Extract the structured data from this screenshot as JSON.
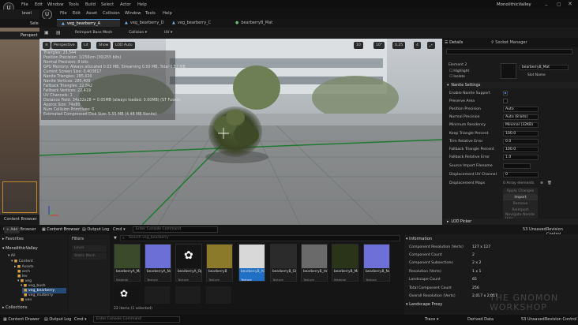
{
  "app": {
    "project": "MonolithicValley"
  },
  "menu": [
    "File",
    "Edit",
    "Window",
    "Tools",
    "Build",
    "Select",
    "Actor",
    "Help"
  ],
  "inner_menu": [
    "File",
    "Edit",
    "Asset",
    "Collision",
    "Window",
    "Tools",
    "Help"
  ],
  "outer_tabs": [
    "level",
    "Sele"
  ],
  "editor_tabs": [
    "veg_bearberry_A",
    "veg_bearberry_D",
    "veg_bearberry_C",
    "bearberryB_Mat"
  ],
  "toolbar": {
    "reimport": "Reimport Base Mesh",
    "collision": "Collision",
    "uv": "UV"
  },
  "viewport": {
    "perspective": "Perspective",
    "lit": "Lit",
    "show": "Show",
    "lod": "LOD Auto",
    "grid": "10",
    "rot": "10°",
    "scale": "0.25",
    "cam": "4",
    "stats": [
      "Triangles: 23,544",
      "Position Precision: 1/256cm (30/255 bits)",
      "Normal Precision: 8 bits",
      "GPU Memory: Always allocated 0.03 MB, Streaming 0.50 MB, Total 0.53 MB",
      "Current Screen Size: 0.403817",
      "Nanite Triangles: 285,020",
      "Nanite Vertices: 285,409",
      "Fallback Triangles: 22,842",
      "Fallback Vertices: 22,419",
      "UV Channels: 1",
      "Distance Field: 34x32x28 = 0.05MB (always loaded: 0.00MB) (ST Fused)",
      "Approx Size: 74x80",
      "Num Collision Primitives: 0",
      "Estimated Compressed Disk Size: 5.55 MB (4.48 MB Nanite)"
    ]
  },
  "details": {
    "tab": "Details",
    "tab2": "Socket Manager",
    "element": "Element 2",
    "mat_name": "bearberryB_Mat",
    "highlight": "Highlight",
    "isolate": "Isolate",
    "slot": "Slot Name",
    "nanite_section": "Nanite Settings",
    "rows": [
      {
        "label": "Enable Nanite Support",
        "type": "check",
        "on": true
      },
      {
        "label": "Preserve Area",
        "type": "check",
        "on": false
      },
      {
        "label": "Position Precision",
        "value": "Auto"
      },
      {
        "label": "Normal Precision",
        "value": "Auto (8 bits)"
      },
      {
        "label": "Minimum Residency",
        "value": "Minimal (32KB)"
      },
      {
        "label": "Keep Triangle Percent",
        "value": "100.0"
      },
      {
        "label": "Trim Relative Error",
        "value": "0.0"
      },
      {
        "label": "Fallback Triangle Percent",
        "value": "100.0"
      },
      {
        "label": "Fallback Relative Error",
        "value": "1.0"
      },
      {
        "label": "Source Import Filename",
        "value": ""
      },
      {
        "label": "Displacement UV Channel",
        "value": "0"
      }
    ],
    "displacement": "Displacement Maps",
    "array": "0 Array elements",
    "buttons": [
      "Apply Changes",
      "Import",
      "Remove",
      "Reimport",
      "Navigate Nanite Hier"
    ],
    "lod_picker": "LOD Picker"
  },
  "bottom_tabs": {
    "cb": "Content Browser",
    "ol": "Output Log",
    "cmd": "Cmd",
    "console": "Enter Console Command"
  },
  "content": {
    "add": "Add",
    "favorites": "Favorites",
    "project": "MonolithicValley",
    "filters": "Filters",
    "level": "Level",
    "static_mesh": "Static Mesh",
    "search": "Search veg_bearberry",
    "path": [
      "All",
      "Content",
      "veg",
      "veg_bush",
      "veg_bearberry"
    ],
    "tree": [
      "All",
      "Content",
      "Assets",
      "arch",
      "lev",
      "veg",
      "veg_bush",
      "veg_bearberry",
      "veg_mulberry",
      "ven"
    ],
    "collections": "Collections",
    "count": "22 items (1 selected)",
    "assets": [
      {
        "name": "bearberryA_Mat",
        "type": "Material",
        "color": "#3b4a2a"
      },
      {
        "name": "bearberryA_Normal",
        "type": "Texture",
        "color": "#6b6fd6"
      },
      {
        "name": "bearberryA_Opacity",
        "type": "Texture",
        "color": "#141414"
      },
      {
        "name": "bearberryB",
        "type": "Texture",
        "color": "#8b7a2a"
      },
      {
        "name": "bearberryB_AO",
        "type": "Texture",
        "color": "#d8d8d8"
      },
      {
        "name": "bearberryB_Gloss",
        "type": "Texture",
        "color": "#2b2b2b"
      },
      {
        "name": "bearberryB_Height",
        "type": "Texture",
        "color": "#6a6a6a"
      },
      {
        "name": "bearberryB_Mat",
        "type": "Material",
        "color": "#2a3418"
      },
      {
        "name": "bearberryB_Normal",
        "type": "Texture",
        "color": "#6f6fd8"
      }
    ]
  },
  "info": {
    "title": "Information",
    "rows": [
      {
        "k": "Component Resolution (Verts)",
        "v": "127 x 127"
      },
      {
        "k": "Component Count",
        "v": "2"
      },
      {
        "k": "Component Subsections",
        "v": "2 x 2"
      },
      {
        "k": "Resolution (Verts)",
        "v": "1 x 1"
      },
      {
        "k": "Landscape Count",
        "v": "65"
      },
      {
        "k": "Total Component Count",
        "v": "256"
      },
      {
        "k": "Overall Resolution (Verts)",
        "v": "2,017 x 2,017"
      }
    ],
    "proxy": "Landscape Proxy"
  },
  "status": {
    "unsaved": "53 Unsaved",
    "revision": "Revision Control",
    "trace": "Trace",
    "derived": "Derived Data",
    "unsaved2": "53 Unsaved",
    "revision2": "Revision Control",
    "cb": "Content Drawer",
    "ol": "Output Log",
    "cmd": "Cmd",
    "console": "Enter Console Command"
  },
  "watermark": "THE GNOMON WORKSHOP"
}
